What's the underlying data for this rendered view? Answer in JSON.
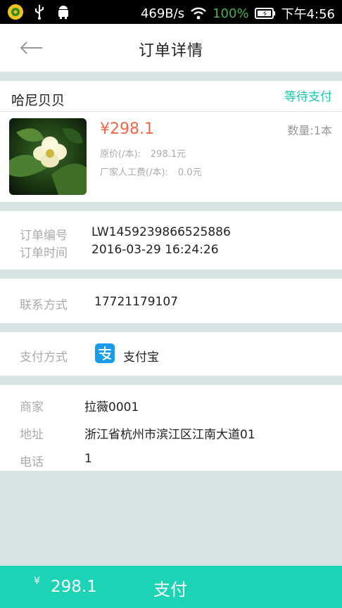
{
  "status_bar": {
    "speed": "469B/s",
    "battery": "100%",
    "time": "下午4:56",
    "icons": [
      "notification-icon",
      "usb-icon",
      "android-icon",
      "wifi-icon",
      "battery-icon"
    ]
  },
  "header": {
    "title": "订单详情",
    "back_icon": "back-arrow-icon"
  },
  "shop": {
    "name": "哈尼贝贝",
    "status": "等待支付"
  },
  "product": {
    "price": "¥298.1",
    "quantity": "数量:1本",
    "original_price_label": "原价(/本):",
    "original_price_value": "298.1元",
    "labor_fee_label": "厂家人工费(/本):",
    "labor_fee_value": "0.0元"
  },
  "order": {
    "number_label": "订单编号",
    "number": "LW1459239866525886",
    "time_label": "订单时间",
    "time": "2016-03-29 16:24:26"
  },
  "contact": {
    "label": "联系方式",
    "phone": "17721179107"
  },
  "payment": {
    "label": "支付方式",
    "method": "支付宝",
    "icon": "alipay-icon"
  },
  "merchant": {
    "name_label": "商家",
    "name": "拉薇0001",
    "address_label": "地址",
    "address": "浙江省杭州市滨江区江南大道01",
    "phone_label": "电话",
    "phone": "1"
  },
  "bottom": {
    "currency": "¥",
    "total": "298.1",
    "pay_label": "支付"
  },
  "colors": {
    "accent": "#1dd3b6",
    "status": "#1cc6ad",
    "price": "#f06743",
    "background": "#d6e4e4"
  }
}
